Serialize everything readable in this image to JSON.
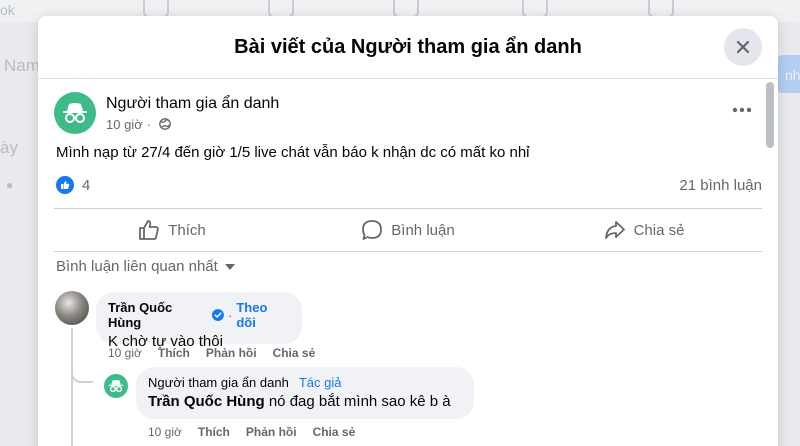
{
  "background": {
    "frag_search": "ok",
    "frag_name": "Nam",
    "frag_day": "ày",
    "frag_button": "nhó"
  },
  "modal": {
    "title": "Bài viết của Người tham gia ẩn danh"
  },
  "post": {
    "author": "Người tham gia ẩn danh",
    "time": "10 giờ",
    "text": "Mình nạp từ 27/4 đến giờ 1/5 live chát vẫn báo k nhận dc có mất ko nhỉ",
    "like_count": "4",
    "comment_count": "21 bình luận"
  },
  "actions": {
    "like": "Thích",
    "comment": "Bình luận",
    "share": "Chia sẻ"
  },
  "comment_filter": "Bình luận liên quan nhất",
  "comments": [
    {
      "author": "Trần Quốc Hùng",
      "verified": true,
      "follow_label": "Theo dõi",
      "text": "K chờ tự vào thôi",
      "time": "10 giờ",
      "like": "Thích",
      "reply": "Phản hồi",
      "share": "Chia sẻ"
    },
    {
      "author": "Người tham gia ẩn danh",
      "author_tag": "Tác giả",
      "mention": "Trần Quốc Hùng",
      "text": "nó đag bắt mình sao kê b à",
      "time": "10 giờ",
      "like": "Thích",
      "reply": "Phản hồi",
      "share": "Chia sẻ"
    }
  ],
  "colors": {
    "brand_blue": "#1877f2",
    "anon_green": "#3dbb88",
    "bubble_gray": "#f0f2f5",
    "secondary_text": "#65676b"
  },
  "icons": {
    "close": "close-icon",
    "more": "more-dots-icon",
    "globe": "globe-icon",
    "like": "thumbs-up-icon",
    "comment": "comment-bubble-icon",
    "share": "share-arrow-icon",
    "anonymous": "incognito-icon",
    "verified": "verified-badge-icon",
    "caret": "caret-down-icon"
  }
}
